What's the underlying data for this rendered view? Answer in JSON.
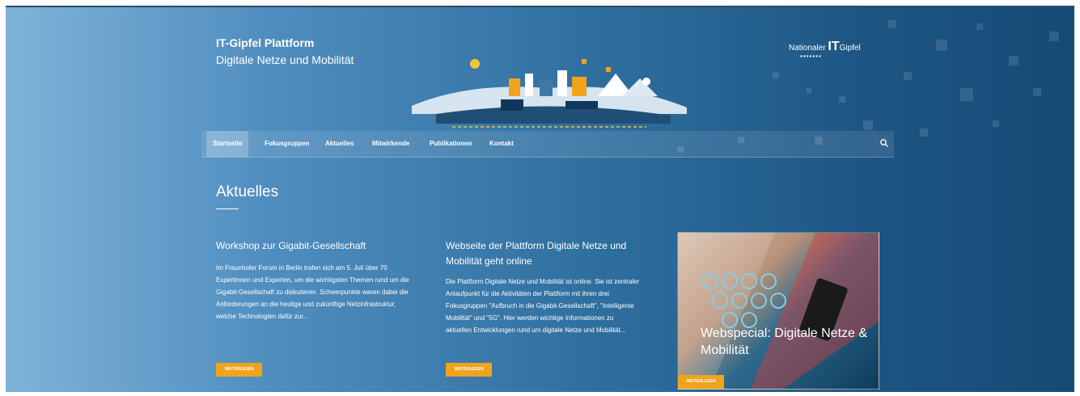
{
  "header": {
    "title": "IT-Gipfel Plattform",
    "subtitle": "Digitale Netze und Mobilität",
    "logo": {
      "prefix": "Nationaler",
      "strong": "IT",
      "suffix": "Gipfel"
    }
  },
  "nav": {
    "items": [
      "Startseite",
      "Fokusgruppen",
      "Aktuelles",
      "Mitwirkende",
      "Publikationen",
      "Kontakt"
    ],
    "active_index": 0,
    "search_icon": "search-icon"
  },
  "section": {
    "title": "Aktuelles"
  },
  "articles": [
    {
      "title": "Workshop zur Gigabit-Gesellschaft",
      "text": "Im Fraunhofer Forum in Berlin trafen sich am 5. Juli über 70 Expertinnen und Experten, um die wichtigsten Themen rund um die Gigabit-Gesellschaft zu diskutieren. Schwerpunkte waren dabei die Anforderungen an die heutige und zukünftige Netzinfrastruktur, welche Technologien dafür zur...",
      "button": "weiterlesen"
    },
    {
      "title": "Webseite der Plattform Digitale Netze und Mobilität geht online",
      "text": "Die Plattform Digitale Netze und Mobilität ist online. Sie ist zentraler Anlaufpunkt für die Aktivitäten der Plattform mit ihren drei Fokusgruppen \"Aufbruch in die Gigabit-Gesellschaft\", \"Intelligente Mobilität\" und \"5G\". Hier werden wichtige Informationen zu aktuellen Entwicklungen rund um digitale Netze und Mobilität...",
      "button": "weiterlesen"
    }
  ],
  "webspecial": {
    "title": "Webspecial: Digitale Netze & Mobilität",
    "button": "weiterlesen"
  },
  "colors": {
    "accent": "#f0a31c",
    "background_start": "#7fb3d8",
    "background_end": "#164a76"
  }
}
